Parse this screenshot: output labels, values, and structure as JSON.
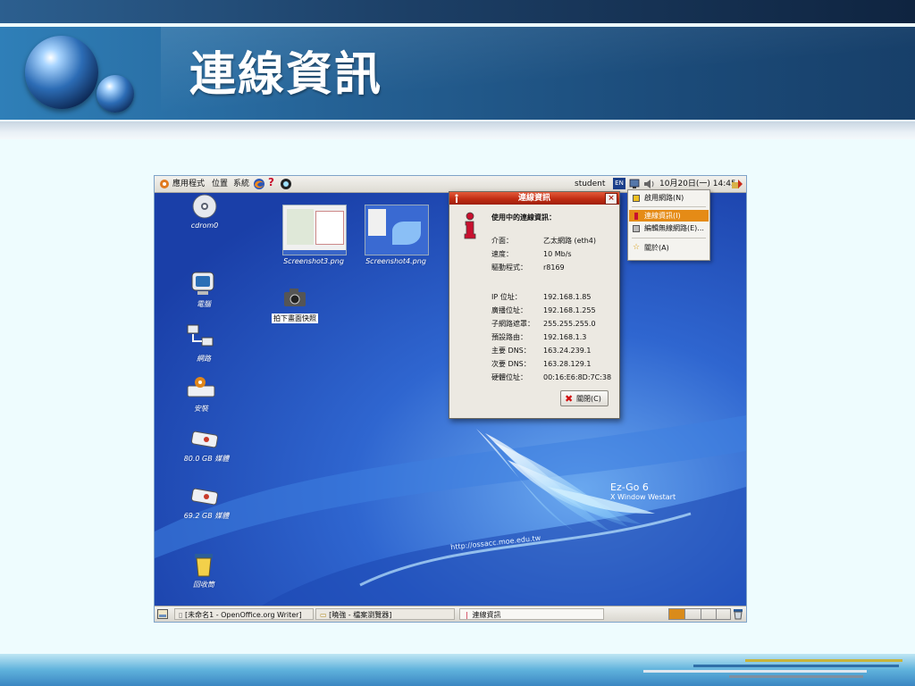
{
  "slide": {
    "title": "連線資訊"
  },
  "top_panel": {
    "apps": "應用程式",
    "places": "位置",
    "system": "系統",
    "user": "student",
    "lang": "EN",
    "clock": "10月20日(一) 14:45"
  },
  "desktop": {
    "icons": [
      "cdrom0",
      "電腦",
      "網路",
      "安裝",
      "80.0 GB 媒體",
      "69.2 GB 媒體",
      "回收筒"
    ],
    "screenshots": [
      "Screenshot3.png",
      "Screenshot4.png"
    ],
    "camera_label": "拍下畫面快照",
    "wallpaper_brand": "Ez-Go 6",
    "wallpaper_sub": "X Window Westart",
    "wallpaper_url": "http://ossacc.moe.edu.tw"
  },
  "dialog": {
    "title": "連線資訊",
    "close_x": "×",
    "heading": "使用中的連線資訊：",
    "rows": [
      {
        "k": "介面：",
        "v": "乙太網路 (eth4)"
      },
      {
        "k": "速度：",
        "v": "10 Mb/s"
      },
      {
        "k": "驅動程式：",
        "v": "r8169"
      },
      {
        "k": "IP 位址：",
        "v": "192.168.1.85"
      },
      {
        "k": "廣播位址：",
        "v": "192.168.1.255"
      },
      {
        "k": "子網路遮罩：",
        "v": "255.255.255.0"
      },
      {
        "k": "預設路由：",
        "v": "192.168.1.3"
      },
      {
        "k": "主要 DNS：",
        "v": "163.24.239.1"
      },
      {
        "k": "次要 DNS：",
        "v": "163.28.129.1"
      },
      {
        "k": "硬體位址：",
        "v": "00:16:E6:8D:7C:38"
      }
    ],
    "close_button": "關閉(C)"
  },
  "menu": {
    "items": [
      "啟用網路(N)",
      "連線資訊(I)",
      "編輯無線網路(E)...",
      "關於(A)"
    ]
  },
  "taskbar": {
    "tasks": [
      "[未命名1 - OpenOffice.org Writer]",
      "[曉強 - 檔案瀏覽器]",
      "連線資訊"
    ]
  },
  "colors": {
    "header": "#245f92",
    "dialog_title": "#c12d14",
    "menu_highlight": "#e58b16",
    "desktop": "#2d63c8"
  }
}
